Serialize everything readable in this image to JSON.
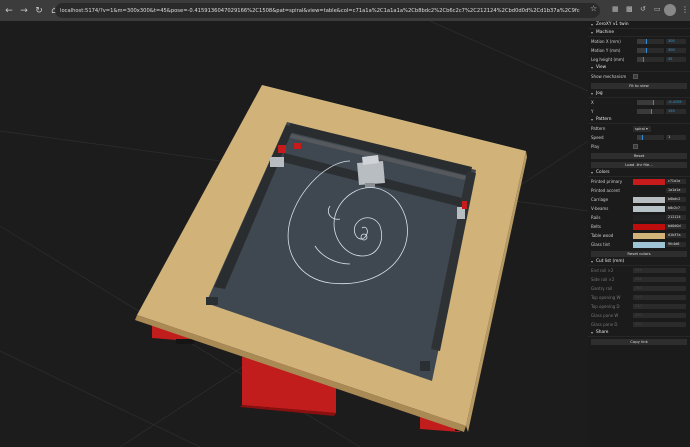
{
  "browser": {
    "url": "localhost:5174/?v=1&m=300x300&t=45&pose=-0.4159136047029166%2C1508&pat=spiral&view=table&col=c71a1a%2C1a1a1a%2Cb8bdc2%2Cb6c2c7%2C212124%2Cbd0d0d%2Cd1b37a%2C9fc4d6&cam=0.02237575792952..."
  },
  "panel": {
    "title": "ZeroXY v1 twin",
    "machine": {
      "label": "Machine",
      "rows": [
        {
          "label": "Motion X (mm)",
          "value": "300",
          "fraction": 0.33
        },
        {
          "label": "Motion Y (mm)",
          "value": "300",
          "fraction": 0.33
        },
        {
          "label": "Leg height (mm)",
          "value": "45",
          "fraction": 0.22
        }
      ]
    },
    "view": {
      "label": "View",
      "show_mechanism": "Show mechanism",
      "fit_button": "Fit to view"
    },
    "jog": {
      "label": "Jog",
      "rows": [
        {
          "label": "X",
          "value": "-0.4159",
          "fraction": 0.58
        },
        {
          "label": "Y",
          "value": "150",
          "fraction": 0.5
        }
      ]
    },
    "pattern": {
      "label": "Pattern",
      "pattern_label": "Pattern",
      "pattern_value": "spiral",
      "speed_label": "Speed",
      "speed_value": "1",
      "speed_fraction": 0.2,
      "play_label": "Play",
      "reset_button": "Reset",
      "load_button": "Load .thr file..."
    },
    "colors": {
      "label": "Colors",
      "items": [
        {
          "label": "Printed primary",
          "hex": "c71a1a",
          "color": "#c71a1a"
        },
        {
          "label": "Printed accent",
          "hex": "1a1a1a",
          "color": "#1a1a1a"
        },
        {
          "label": "Carriage",
          "hex": "b8bdc2",
          "color": "#b8bdc2"
        },
        {
          "label": "V-beams",
          "hex": "b6c2c7",
          "color": "#b6c2c7"
        },
        {
          "label": "Rails",
          "hex": "212124",
          "color": "#212124"
        },
        {
          "label": "Belts",
          "hex": "bd0d0d",
          "color": "#bd0d0d"
        },
        {
          "label": "Table wood",
          "hex": "d1b37a",
          "color": "#d1b37a"
        },
        {
          "label": "Glass tint",
          "hex": "9fc4d6",
          "color": "#9fc4d6"
        }
      ],
      "reset_button": "Reset colors"
    },
    "cutlist": {
      "label": "Cut list (mm)",
      "rows": [
        {
          "label": "End rail ×2",
          "value": "424"
        },
        {
          "label": "Side rail ×2",
          "value": "384"
        },
        {
          "label": "Gantry rail",
          "value": "384"
        },
        {
          "label": "Top opening W",
          "value": "340"
        },
        {
          "label": "Top opening D",
          "value": "340"
        },
        {
          "label": "Glass pane W",
          "value": "350"
        },
        {
          "label": "Glass pane D",
          "value": "350"
        }
      ]
    },
    "share": {
      "label": "Share",
      "copy_button": "Copy link"
    }
  },
  "colors": {
    "wood": "#d1b37a",
    "glass": "#3f4850",
    "printed_primary": "#c71a1a",
    "accent": "#2d8bd8"
  }
}
